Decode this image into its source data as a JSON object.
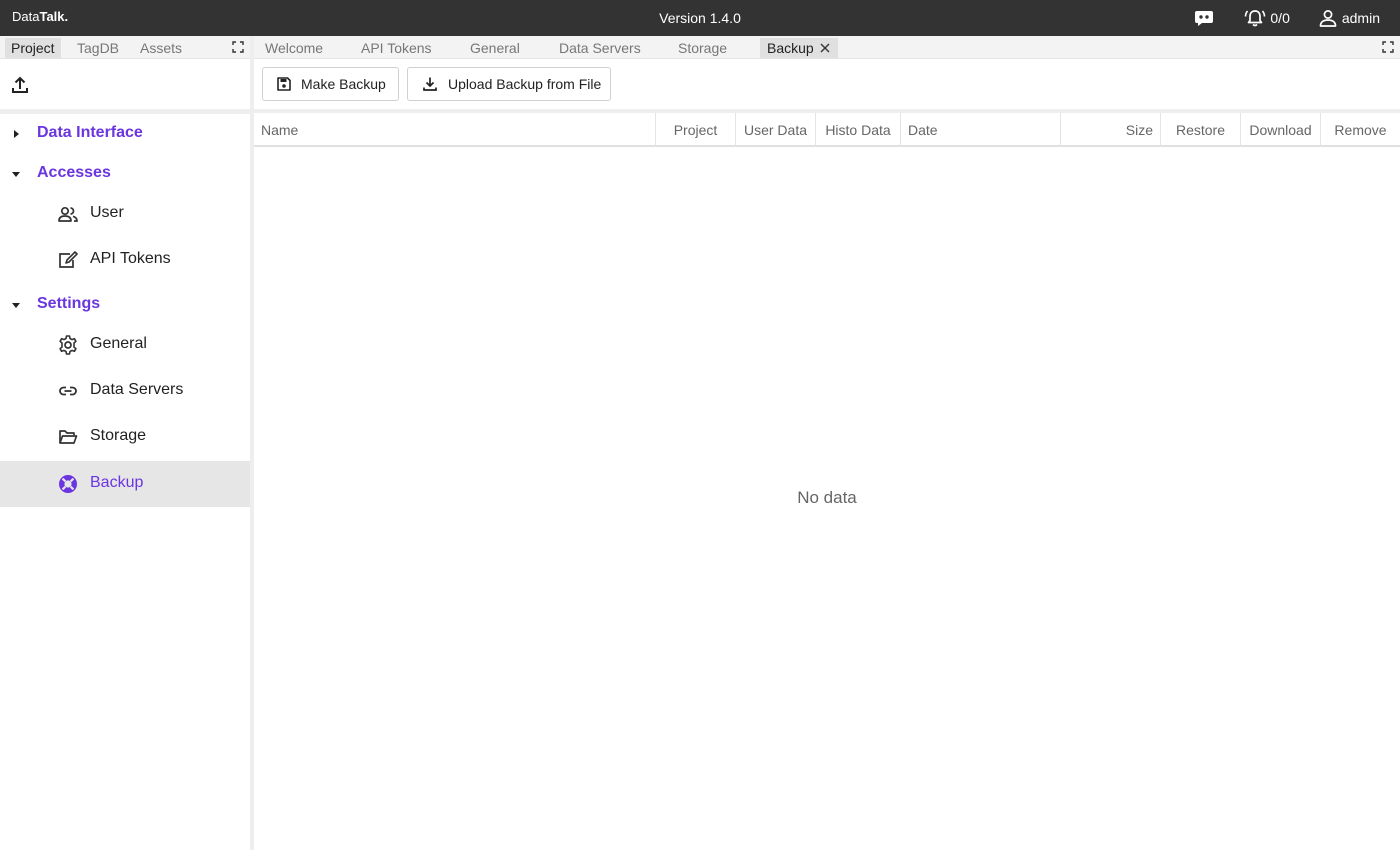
{
  "app": {
    "brand_light": "Data",
    "brand_bold": "Talk.",
    "version": "Version 1.4.0",
    "alarm_count": "0/0",
    "user_name": "admin"
  },
  "left_panel": {
    "tabs": [
      {
        "label": "Project",
        "active": true
      },
      {
        "label": "TagDB",
        "active": false
      },
      {
        "label": "Assets",
        "active": false
      }
    ],
    "tree": {
      "groups": [
        {
          "label": "Data Interface",
          "expanded": false
        },
        {
          "label": "Accesses",
          "expanded": true
        },
        {
          "label": "Settings",
          "expanded": true
        }
      ],
      "accesses_items": [
        {
          "label": "User",
          "icon": "users-icon"
        },
        {
          "label": "API Tokens",
          "icon": "token-edit-icon"
        }
      ],
      "settings_items": [
        {
          "label": "General",
          "icon": "gear-icon"
        },
        {
          "label": "Data Servers",
          "icon": "link-icon"
        },
        {
          "label": "Storage",
          "icon": "folder-open-icon"
        },
        {
          "label": "Backup",
          "icon": "lifebuoy-icon",
          "selected": true
        }
      ]
    }
  },
  "main": {
    "tabs": [
      {
        "label": "Welcome"
      },
      {
        "label": "API Tokens"
      },
      {
        "label": "General"
      },
      {
        "label": "Data Servers"
      },
      {
        "label": "Storage"
      },
      {
        "label": "Backup",
        "active": true,
        "closable": true
      }
    ],
    "toolbar": {
      "make_backup": "Make Backup",
      "upload_backup": "Upload Backup from File"
    },
    "table": {
      "columns": [
        "Name",
        "Project",
        "User Data",
        "Histo Data",
        "Date",
        "Size",
        "Restore",
        "Download",
        "Remove"
      ],
      "rows": [],
      "empty_text": "No data"
    }
  },
  "colors": {
    "topbar": "#333333",
    "accent": "#6b35e0",
    "selected_row": "#e6e6e6"
  }
}
